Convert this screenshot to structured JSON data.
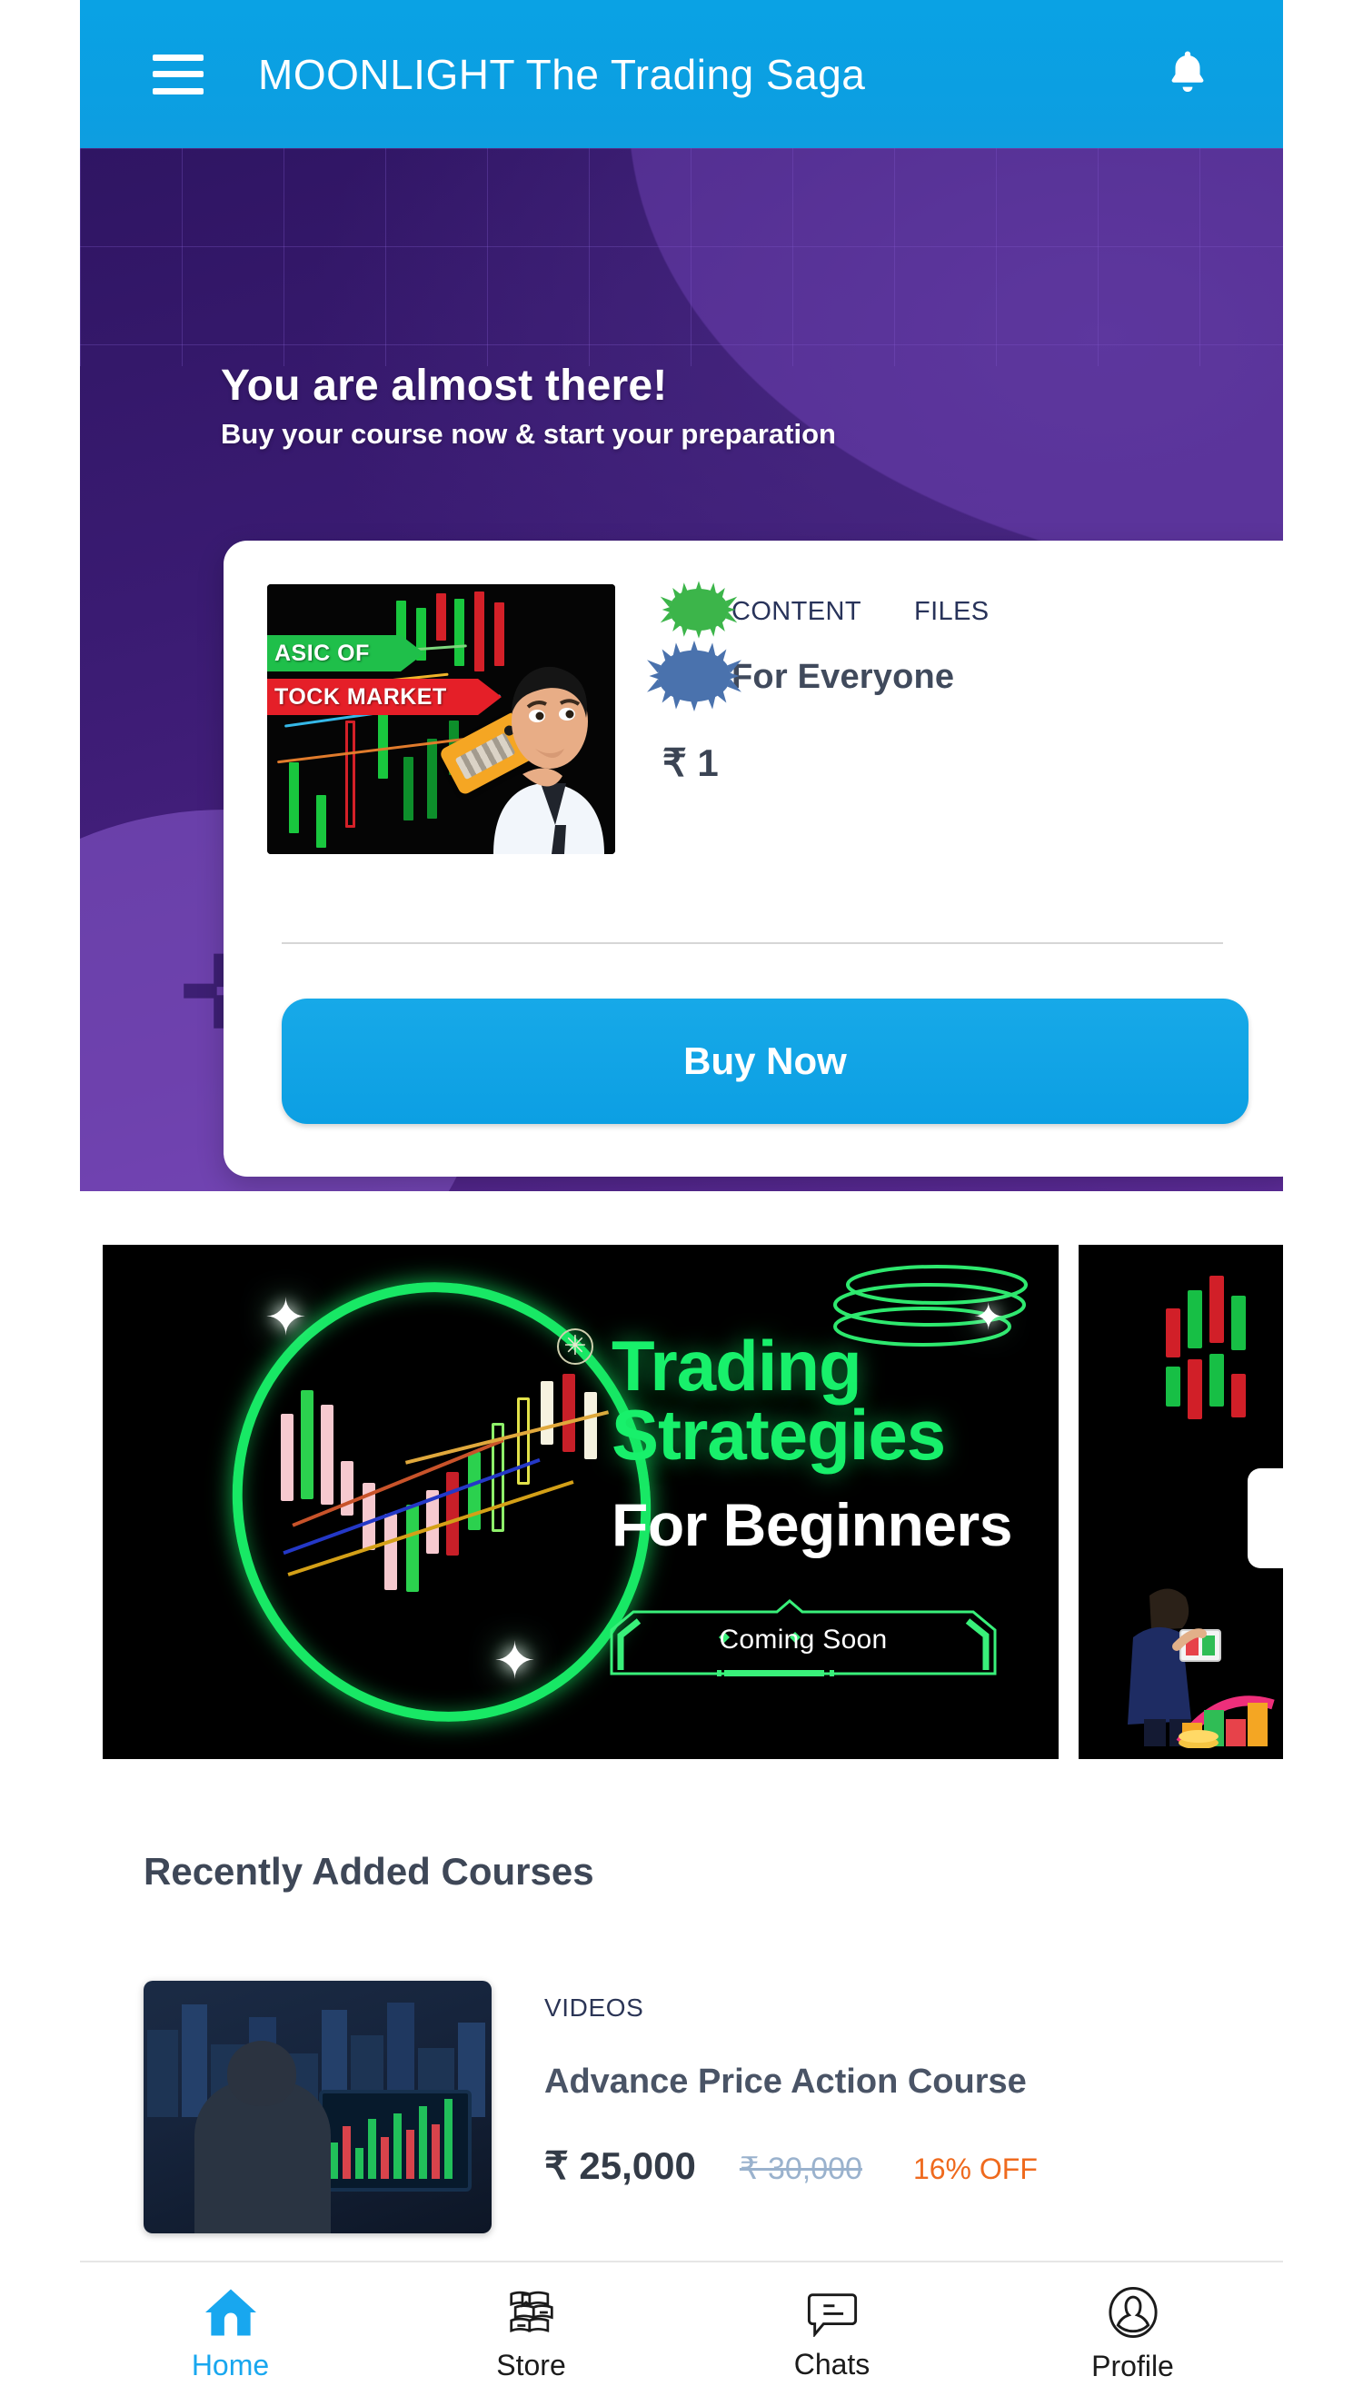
{
  "appbar": {
    "title": "MOONLIGHT The Trading Saga",
    "menu_icon": "hamburger-menu-icon",
    "notification_icon": "bell-icon"
  },
  "hero": {
    "heading": "You are almost there!",
    "subheading": "Buy your course now & start your preparation",
    "card": {
      "thumbnail": {
        "tag_top": "ASIC OF",
        "tag_bottom": "TOCK MARKET",
        "alt": "basic-of-stock-market-thumbnail"
      },
      "meta_content": "CONTENT",
      "meta_files": "FILES",
      "audience": "For Everyone",
      "price": "₹ 1",
      "buy_label": "Buy Now"
    },
    "carousel": {
      "dots": [
        {
          "state": "active"
        },
        {
          "state": "inactive"
        }
      ]
    }
  },
  "banner": {
    "title_line1": "Trading",
    "title_line2": "Strategies",
    "subtitle": "For Beginners",
    "badge": "Coming Soon",
    "asterisk": "✳"
  },
  "recently_added": {
    "section_title": "Recently Added Courses",
    "courses": [
      {
        "kind": "VIDEOS",
        "name": "Advance Price Action Course",
        "price": "₹ 25,000",
        "old_price": "₹ 30,000",
        "discount": "16% OFF",
        "thumbnail_alt": "trader-at-desk-thumbnail"
      }
    ]
  },
  "bottom_nav": {
    "items": [
      {
        "label": "Home",
        "icon": "home-icon",
        "active": true
      },
      {
        "label": "Store",
        "icon": "books-icon",
        "active": false
      },
      {
        "label": "Chats",
        "icon": "chat-bubble-icon",
        "active": false
      },
      {
        "label": "Profile",
        "icon": "person-icon",
        "active": false
      }
    ]
  },
  "colors": {
    "appbar_blue": "#0b9fe2",
    "hero_purple": "#3a1b72",
    "cta_blue": "#0fa2e5",
    "neon_green": "#18f06b",
    "discount_orange": "#ef6a1e",
    "old_price_gray": "#9ab2cd",
    "active_nav": "#18a7ef"
  }
}
